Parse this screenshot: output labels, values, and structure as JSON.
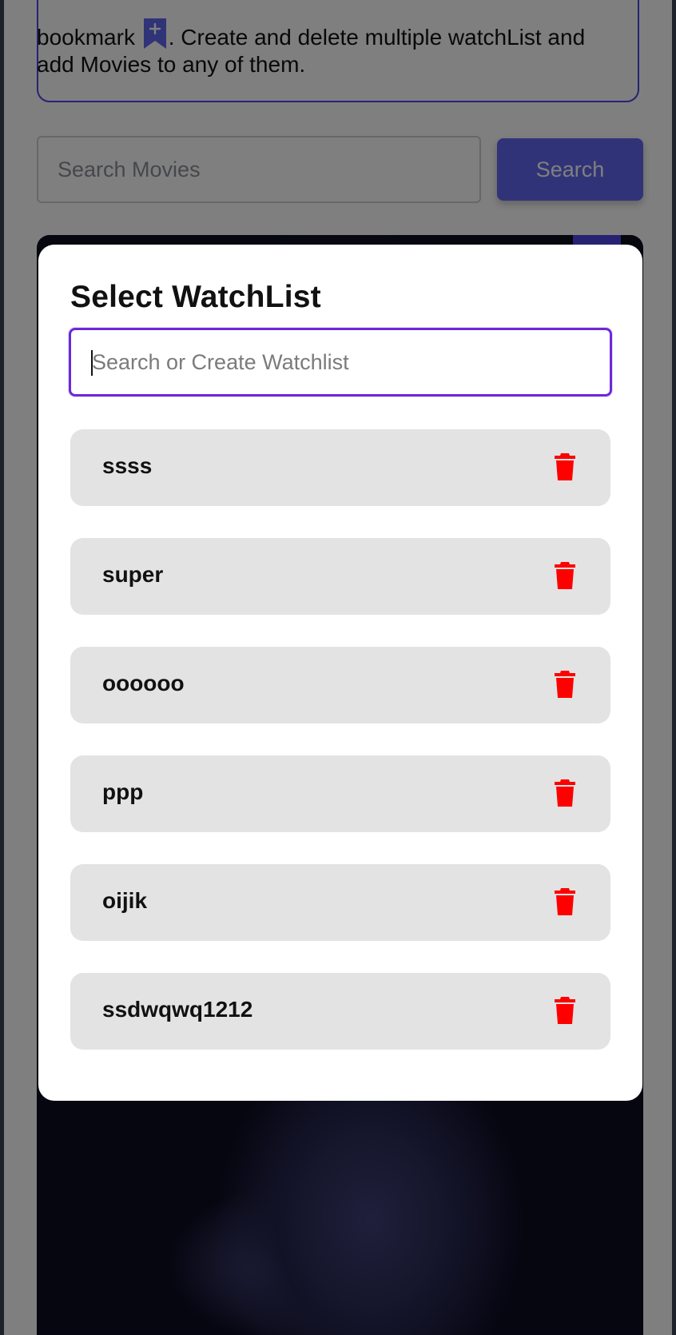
{
  "background": {
    "info_text_before_icon": "bookmark",
    "info_text_after_icon": ". Create and delete multiple watchList and add Movies to any of them.",
    "bookmark_icon": "bookmark-plus-icon",
    "search": {
      "placeholder": "Search Movies",
      "button_label": "Search"
    }
  },
  "modal": {
    "title": "Select WatchList",
    "input_placeholder": "Search or Create Watchlist",
    "watchlists": [
      {
        "name": "ssss"
      },
      {
        "name": "super"
      },
      {
        "name": "oooooo"
      },
      {
        "name": "ppp"
      },
      {
        "name": "oijik"
      },
      {
        "name": "ssdwqwq1212"
      }
    ],
    "delete_icon": "trash-icon"
  },
  "colors": {
    "accent": "#4f46e5",
    "focus_border": "#6d28d9",
    "delete": "#ff0000",
    "item_bg": "#e3e3e3"
  }
}
